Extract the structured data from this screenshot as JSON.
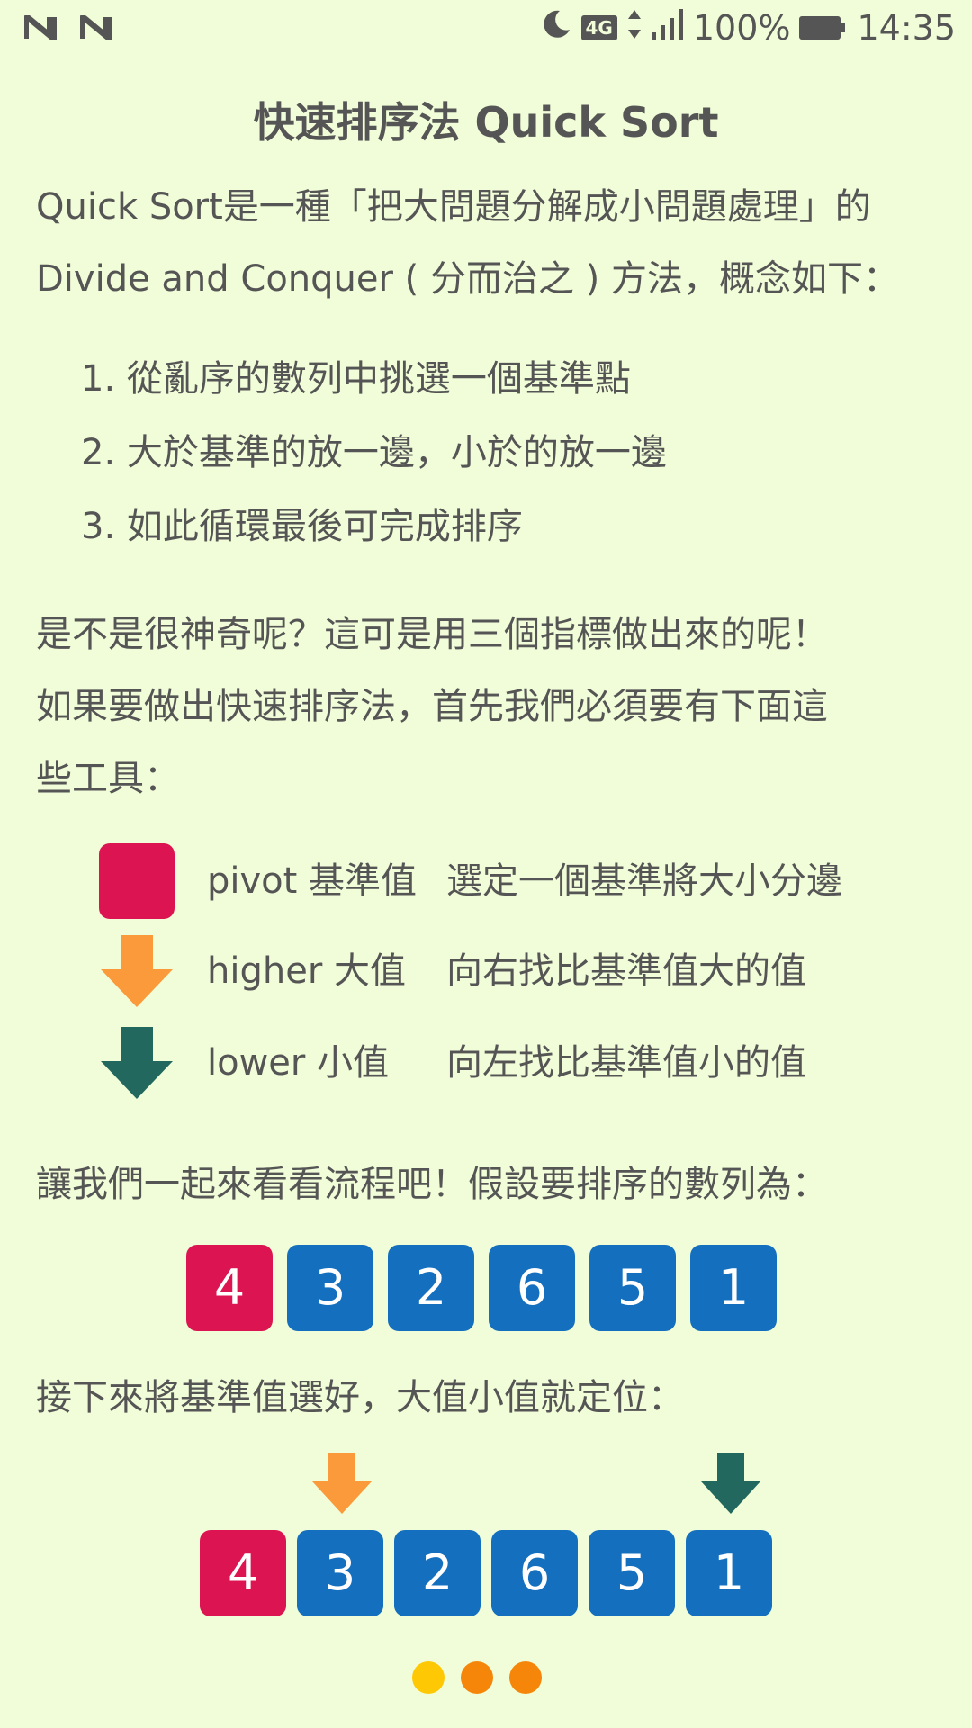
{
  "status_bar": {
    "battery_percent": "100%",
    "network": "4G",
    "time": "14:35",
    "icons": [
      "notification-n-icon",
      "notification-n-icon",
      "moon-icon",
      "4g-icon",
      "data-arrows-icon",
      "signal-icon",
      "battery-icon"
    ]
  },
  "title": "快速排序法 Quick Sort",
  "intro": {
    "line1": "Quick Sort是一種「把大問題分解成小問題處理」的",
    "line2": "Divide and Conquer ( 分而治之 ) 方法，概念如下："
  },
  "steps": [
    "1. 從亂序的數列中挑選一個基準點",
    "2. 大於基準的放一邊，小於的放一邊",
    "3. 如此循環最後可完成排序"
  ],
  "para2": {
    "line1": "是不是很神奇呢？這可是用三個指標做出來的呢！",
    "line2": "如果要做出快速排序法，首先我們必須要有下面這",
    "line3": "些工具："
  },
  "tools": [
    {
      "name": "pivot 基準值",
      "desc": "選定一個基準將大小分邊",
      "icon": "pivot-square-icon"
    },
    {
      "name": "higher 大值",
      "desc": "向右找比基準值大的值",
      "icon": "orange-down-arrow-icon"
    },
    {
      "name": "lower 小值",
      "desc": "向左找比基準值小的值",
      "icon": "green-down-arrow-icon"
    }
  ],
  "para3": "讓我們一起來看看流程吧！假設要排序的數列為：",
  "sequence1": [
    "4",
    "3",
    "2",
    "6",
    "5",
    "1"
  ],
  "para4": "接下來將基準值選好，大值小值就定位：",
  "sequence2": [
    "4",
    "3",
    "2",
    "6",
    "5",
    "1"
  ],
  "colors": {
    "background": "#f1fdd8",
    "pivot": "#dc1552",
    "number_box": "#1470bf",
    "higher_arrow": "#fb9a3a",
    "lower_arrow": "#22685f",
    "dot_active": "#ffc805",
    "dot_inactive": "#f5860a"
  },
  "pager": {
    "count": 3,
    "active_index": 0
  }
}
